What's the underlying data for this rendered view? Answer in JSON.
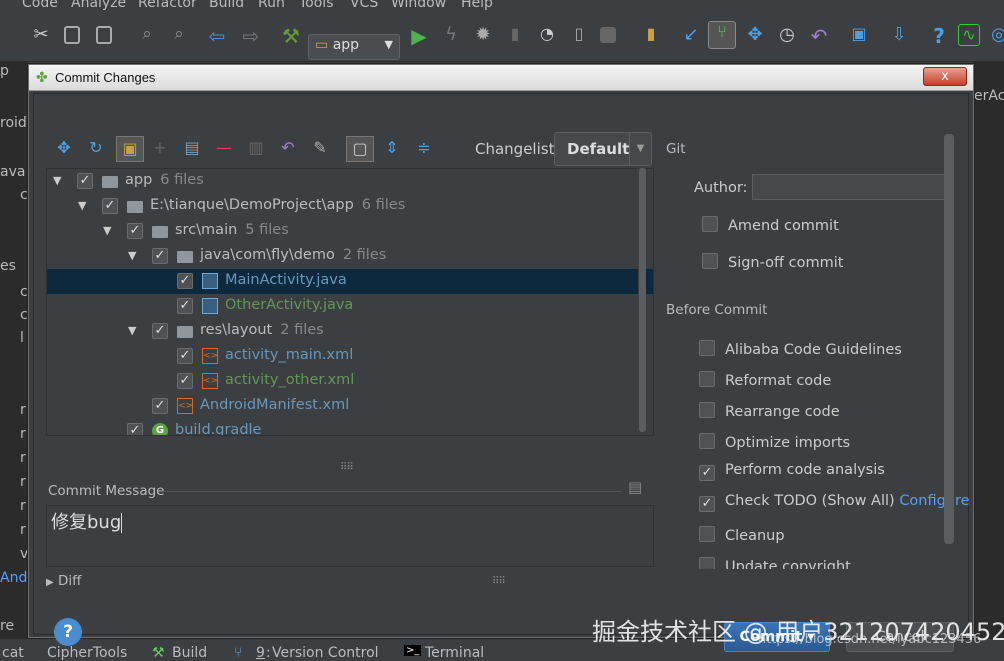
{
  "ide": {
    "menu": [
      "Code",
      "Analyze",
      "Refactor",
      "Build",
      "Run",
      "Tools",
      "VCS",
      "Window",
      "Help"
    ],
    "run_config": "app",
    "left_strip": [
      "p",
      "roidT",
      "ava",
      "c",
      "es",
      "c",
      "c",
      "l",
      "r",
      "r",
      "r",
      "r",
      "r",
      "r",
      "v",
      "Andr",
      "re"
    ],
    "right_strip": "erAc",
    "status": {
      "cat": "cat",
      "cipher": "CipherTools",
      "build": "Build",
      "vcs_num": "9",
      "vcs": "Version Control",
      "terminal": "Terminal"
    }
  },
  "dialog": {
    "title": "Commit Changes",
    "close": "x",
    "changelist_label": "Changelist:",
    "changelist_value": "Default",
    "tree": [
      {
        "label": "app",
        "count": "6 files",
        "color": "#bbbbbb"
      },
      {
        "label": "E:\\tianque\\DemoProject\\app",
        "count": "6 files",
        "color": "#bbbbbb"
      },
      {
        "label": "src\\main",
        "count": "5 files",
        "color": "#bbbbbb"
      },
      {
        "label": "java\\com\\fly\\demo",
        "count": "2 files",
        "color": "#bbbbbb"
      },
      {
        "label": "MainActivity.java",
        "count": "",
        "color": "#6897bb"
      },
      {
        "label": "OtherActivity.java",
        "count": "",
        "color": "#629755"
      },
      {
        "label": "res\\layout",
        "count": "2 files",
        "color": "#bbbbbb"
      },
      {
        "label": "activity_main.xml",
        "count": "",
        "color": "#6897bb"
      },
      {
        "label": "activity_other.xml",
        "count": "",
        "color": "#629755"
      },
      {
        "label": "AndroidManifest.xml",
        "count": "",
        "color": "#6897bb"
      },
      {
        "label": "build.gradle",
        "count": "",
        "color": "#6897bb"
      }
    ],
    "commit_message_label": "Commit Message",
    "commit_message": "修复bug",
    "diff_label": "Diff",
    "git_label": "Git",
    "author_label": "Author:",
    "author_value": "",
    "amend": "Amend commit",
    "signoff": "Sign-off commit",
    "before_commit_label": "Before Commit",
    "checks": [
      {
        "label": "Alibaba Code Guidelines",
        "checked": false
      },
      {
        "label": "Reformat code",
        "checked": false
      },
      {
        "label": "Rearrange code",
        "checked": false
      },
      {
        "label": "Optimize imports",
        "checked": false
      },
      {
        "label": "Perform code analysis",
        "checked": true
      },
      {
        "label": "Check TODO (Show All)",
        "checked": true
      },
      {
        "label": "Cleanup",
        "checked": false
      },
      {
        "label": "Update copyright",
        "checked": false
      }
    ],
    "configure_link": "Configure",
    "commit_button": "Commit ▾",
    "cancel_button": "Cancel",
    "help": "?"
  },
  "watermark": {
    "main": "掘金技术社区 @ 用户321207420452",
    "sub": "https://blog.csdn.net/lyabc123456"
  },
  "colors": {
    "accent": "#589df6",
    "selection": "#0d293e",
    "commit": "#2b5a92"
  }
}
